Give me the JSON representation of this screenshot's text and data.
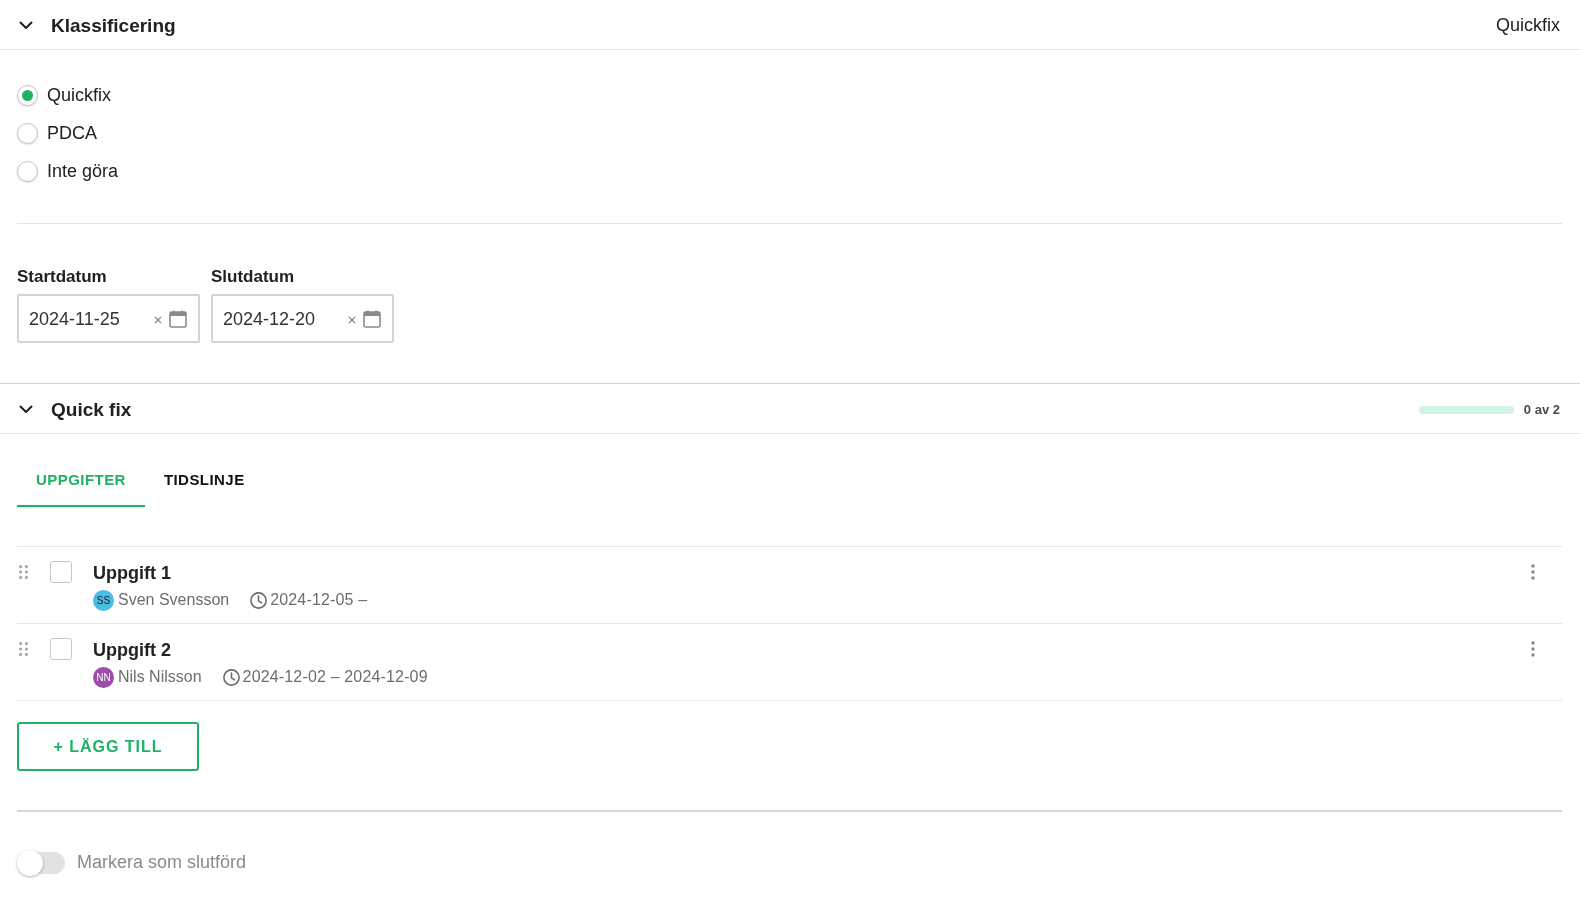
{
  "classification": {
    "title": "Klassificering",
    "expanded": true,
    "summary": "Quickfix",
    "options": [
      {
        "label": "Quickfix",
        "selected": true
      },
      {
        "label": "PDCA",
        "selected": false
      },
      {
        "label": "Inte göra",
        "selected": false
      }
    ],
    "dates": [
      {
        "label": "Startdatum",
        "value": "2024-11-25"
      },
      {
        "label": "Slutdatum",
        "value": "2024-12-20"
      }
    ]
  },
  "quick_fix": {
    "title": "Quick fix",
    "expanded": true,
    "progress": {
      "level": 0,
      "reading": "0 av 2"
    },
    "tabs": [
      {
        "label": "UPPGIFTER",
        "selected": true
      },
      {
        "label": "TIDSLINJE",
        "selected": false
      }
    ],
    "tasks": [
      {
        "title": "Uppgift 1",
        "checked": false,
        "assignee": {
          "initials": "SS",
          "name": "Sven Svensson",
          "color": "#45bfe8"
        },
        "dates": "2024-12-05 –"
      },
      {
        "title": "Uppgift 2",
        "checked": false,
        "assignee": {
          "initials": "NN",
          "name": "Nils Nilsson",
          "color": "#9a4ea6"
        },
        "dates": "2024-12-02 – 2024-12-09"
      }
    ],
    "add_button": "+ LÄGG TILL"
  },
  "complete_toggle": {
    "label": "Markera som slutförd",
    "on": false
  }
}
